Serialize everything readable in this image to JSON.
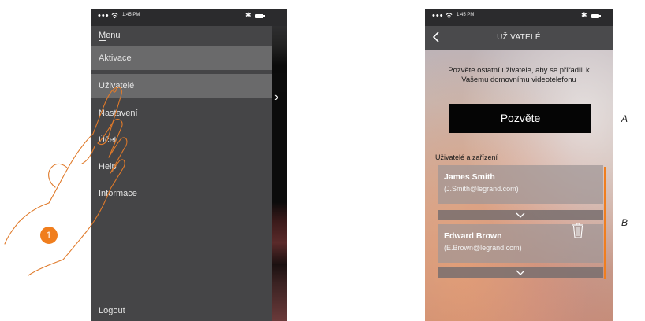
{
  "left_screen": {
    "status": {
      "dots": "•••",
      "time": "1:45 PM",
      "bluetooth": "✱"
    },
    "menu_title": "Menu",
    "items": [
      {
        "label": "Aktivace",
        "selected": true
      },
      {
        "label": "Uživatelé",
        "selected": true
      },
      {
        "label": "Nastavení",
        "selected": false
      },
      {
        "label": "Účet",
        "selected": false
      },
      {
        "label": "Help",
        "selected": false
      },
      {
        "label": "Informace",
        "selected": false
      }
    ],
    "logout": "Logout",
    "peek_chevron": "›",
    "step_number": "1",
    "colors": {
      "accent": "#f07e1e",
      "menu_bg": "#454547",
      "highlight": "#6a6a6b"
    }
  },
  "right_screen": {
    "status": {
      "dots": "•••",
      "time": "1:45 PM",
      "bluetooth": "✱"
    },
    "title": "UŽIVATELÉ",
    "intro": "Pozvěte ostatní uživatele, aby se přiřadili k Vašemu domovnímu videotelefonu",
    "invite_button": "Pozvěte",
    "section_label": "Uživatelé a zařízení",
    "users": [
      {
        "name": "James Smith",
        "email": "(J.Smith@legrand.com)",
        "icon": "chevron-down-icon"
      },
      {
        "name": "Edward Brown",
        "email": "(E.Brown@legrand.com)",
        "icon": "trash-icon"
      }
    ]
  },
  "callouts": {
    "a": "A",
    "b": "B"
  }
}
